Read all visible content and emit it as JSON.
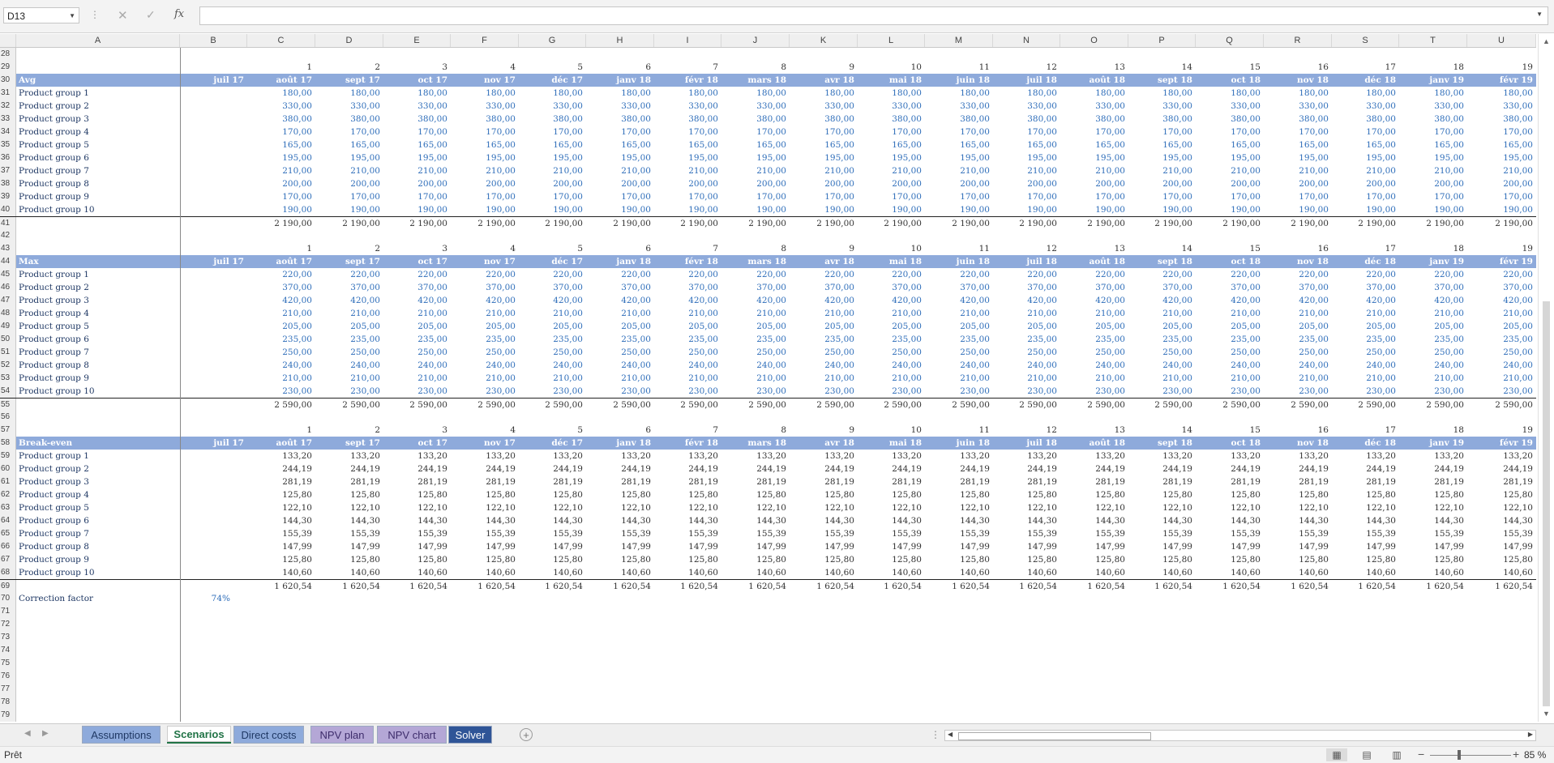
{
  "formula_bar": {
    "name_box": "D13",
    "fx": "fx",
    "formula": "",
    "cancel_icon": "✕",
    "enter_icon": "✓",
    "dots": "⋮"
  },
  "columns": [
    "A",
    "B",
    "C",
    "D",
    "E",
    "F",
    "G",
    "H",
    "I",
    "J",
    "K",
    "L",
    "M",
    "N",
    "O",
    "P",
    "Q",
    "R",
    "S",
    "T",
    "U"
  ],
  "months": [
    "juil 17",
    "août 17",
    "sept 17",
    "oct 17",
    "nov 17",
    "déc 17",
    "janv 18",
    "févr 18",
    "mars 18",
    "avr 18",
    "mai 18",
    "juin 18",
    "juil 18",
    "août 18",
    "sept 18",
    "oct 18",
    "nov 18",
    "déc 18",
    "janv 19",
    "févr 19"
  ],
  "indices": [
    "1",
    "2",
    "3",
    "4",
    "5",
    "6",
    "7",
    "8",
    "9",
    "10",
    "11",
    "12",
    "13",
    "14",
    "15",
    "16",
    "17",
    "18",
    "19"
  ],
  "products": [
    "Product group 1",
    "Product group 2",
    "Product group 3",
    "Product group 4",
    "Product group 5",
    "Product group 6",
    "Product group 7",
    "Product group 8",
    "Product group 9",
    "Product group 10"
  ],
  "sections": [
    {
      "title": "Avg",
      "idx_row": 29,
      "hdr_row": 30,
      "total_row": 41,
      "total": "2 190,00",
      "values": [
        "180,00",
        "330,00",
        "380,00",
        "170,00",
        "165,00",
        "195,00",
        "210,00",
        "200,00",
        "170,00",
        "190,00"
      ]
    },
    {
      "title": "Max",
      "idx_row": 43,
      "hdr_row": 44,
      "total_row": 55,
      "total": "2 590,00",
      "values": [
        "220,00",
        "370,00",
        "420,00",
        "210,00",
        "205,00",
        "235,00",
        "250,00",
        "240,00",
        "210,00",
        "230,00"
      ]
    },
    {
      "title": "Break-even",
      "idx_row": 57,
      "hdr_row": 58,
      "total_row": 69,
      "total": "1 620,54",
      "values": [
        "133,20",
        "244,19",
        "281,19",
        "125,80",
        "122,10",
        "144,30",
        "155,39",
        "147,99",
        "125,80",
        "140,60"
      ]
    }
  ],
  "correction": {
    "label": "Correction factor",
    "value": "74%"
  },
  "sheet_tabs": [
    {
      "label": "Assumptions",
      "bg": "#8eaadb",
      "fg": "#1f3864",
      "active": false
    },
    {
      "label": "Scenarios",
      "bg": "#ffffff",
      "fg": "#217346",
      "active": true
    },
    {
      "label": "Direct costs",
      "bg": "#8eaadb",
      "fg": "#1f3864",
      "active": false
    },
    {
      "label": "NPV plan",
      "bg": "#b4a7d6",
      "fg": "#3d2c6b",
      "active": false
    },
    {
      "label": "NPV chart",
      "bg": "#b4a7d6",
      "fg": "#3d2c6b",
      "active": false
    },
    {
      "label": "Solver",
      "bg": "#2f5597",
      "fg": "#ffffff",
      "active": false
    }
  ],
  "status": {
    "text": "Prêt",
    "zoom": "85 %"
  }
}
